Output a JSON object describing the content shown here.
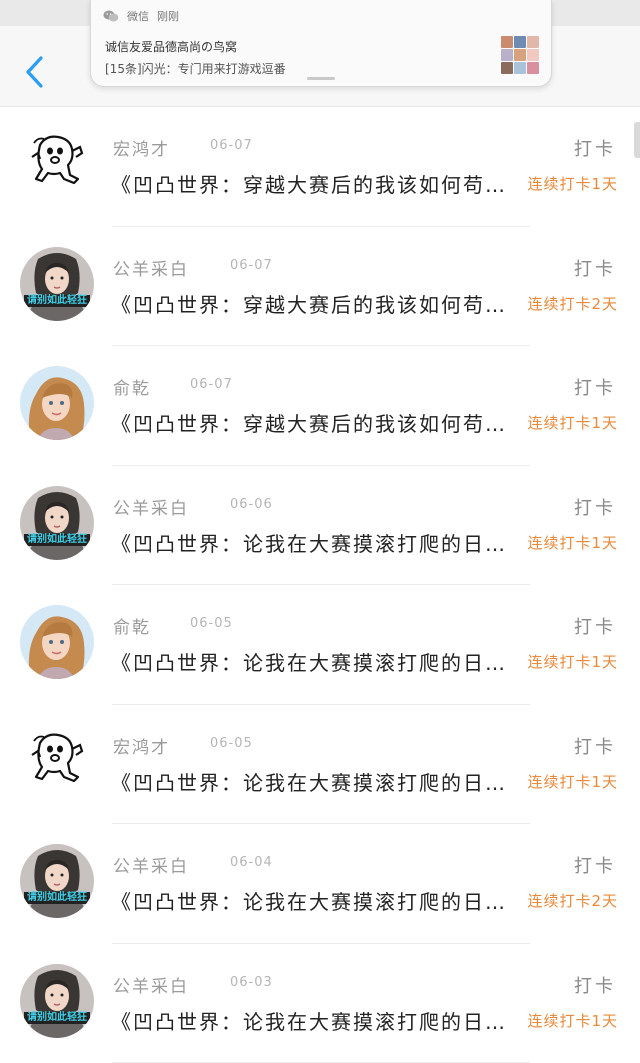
{
  "notification": {
    "app_name": "微信",
    "time": "刚刚",
    "title": "诚信友爱品德高尚の鸟窝",
    "body": "[15条]闪光：专门用来打游戏逗番"
  },
  "header": {
    "back_icon": "chevron-left-icon",
    "accent_color": "#2a9df4"
  },
  "colors": {
    "streak": "#e8893a",
    "name": "#9a9a9a",
    "title": "#222222"
  },
  "list": [
    {
      "avatar": "cartoon",
      "name": "宏鸿才",
      "date": "06-07",
      "title": "《凹凸世界：穿越大赛后的我该如何苟…",
      "checkin": "打卡",
      "streak": "连续打卡1天"
    },
    {
      "avatar": "girl-hoodie",
      "name": "公羊采白",
      "date": "06-07",
      "title": "《凹凸世界：穿越大赛后的我该如何苟…",
      "checkin": "打卡",
      "streak": "连续打卡2天"
    },
    {
      "avatar": "girl-blonde",
      "name": "俞乾",
      "date": "06-07",
      "title": "《凹凸世界：穿越大赛后的我该如何苟…",
      "checkin": "打卡",
      "streak": "连续打卡1天"
    },
    {
      "avatar": "girl-hoodie",
      "name": "公羊采白",
      "date": "06-06",
      "title": "《凹凸世界：论我在大赛摸滚打爬的日…",
      "checkin": "打卡",
      "streak": "连续打卡1天"
    },
    {
      "avatar": "girl-blonde",
      "name": "俞乾",
      "date": "06-05",
      "title": "《凹凸世界：论我在大赛摸滚打爬的日…",
      "checkin": "打卡",
      "streak": "连续打卡1天"
    },
    {
      "avatar": "cartoon",
      "name": "宏鸿才",
      "date": "06-05",
      "title": "《凹凸世界：论我在大赛摸滚打爬的日…",
      "checkin": "打卡",
      "streak": "连续打卡1天"
    },
    {
      "avatar": "girl-hoodie",
      "name": "公羊采白",
      "date": "06-04",
      "title": "《凹凸世界：论我在大赛摸滚打爬的日…",
      "checkin": "打卡",
      "streak": "连续打卡2天"
    },
    {
      "avatar": "girl-hoodie",
      "name": "公羊采白",
      "date": "06-03",
      "title": "《凹凸世界：论我在大赛摸滚打爬的日…",
      "checkin": "打卡",
      "streak": "连续打卡1天"
    }
  ],
  "avatar_caption": "请别如此轻狂"
}
